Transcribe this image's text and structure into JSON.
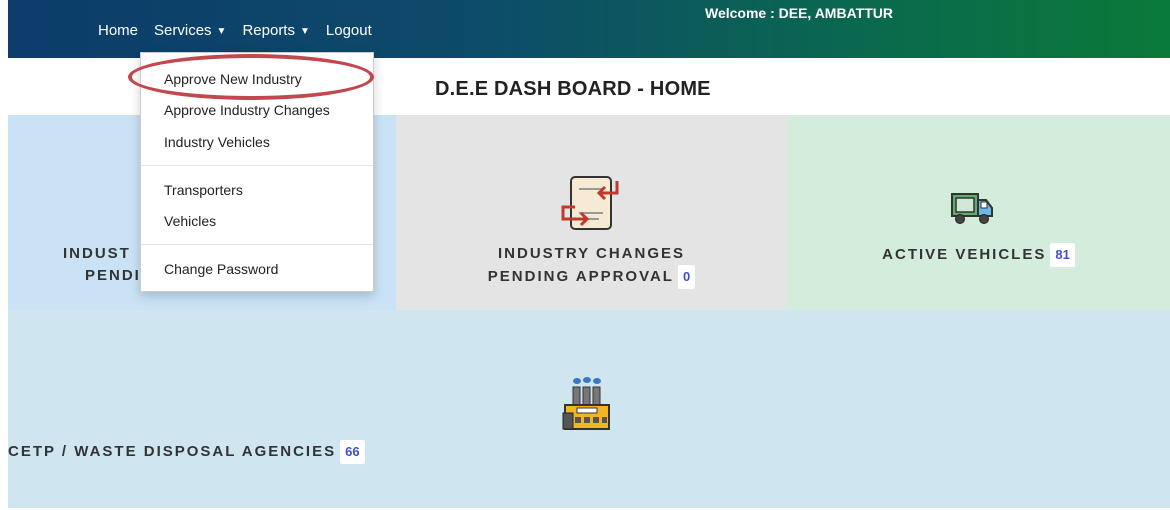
{
  "nav": {
    "home": "Home",
    "services": "Services",
    "reports": "Reports",
    "logout": "Logout",
    "welcome": "Welcome : DEE, AMBATTUR"
  },
  "page_title": "D.E.E DASH BOARD - HOME",
  "services_menu": {
    "items": [
      "Approve New Industry",
      "Approve Industry Changes",
      "Industry Vehicles",
      "Transporters",
      "Vehicles",
      "Change Password"
    ],
    "highlighted": "Approve New Industry"
  },
  "tiles": {
    "industry_pending": {
      "line1": "INDUST",
      "line2": "PENDI"
    },
    "industry_changes": {
      "line1": "INDUSTRY CHANGES",
      "line2": "PENDING APPROVAL",
      "count": "0"
    },
    "active_vehicles": {
      "label": "ACTIVE VEHICLES",
      "count": "81"
    },
    "cetp": {
      "label": "CETP / WASTE DISPOSAL AGENCIES",
      "count": "66"
    }
  },
  "icons": {
    "industry_changes": "document-exchange-icon",
    "active_vehicles": "truck-icon",
    "cetp": "factory-icon"
  }
}
